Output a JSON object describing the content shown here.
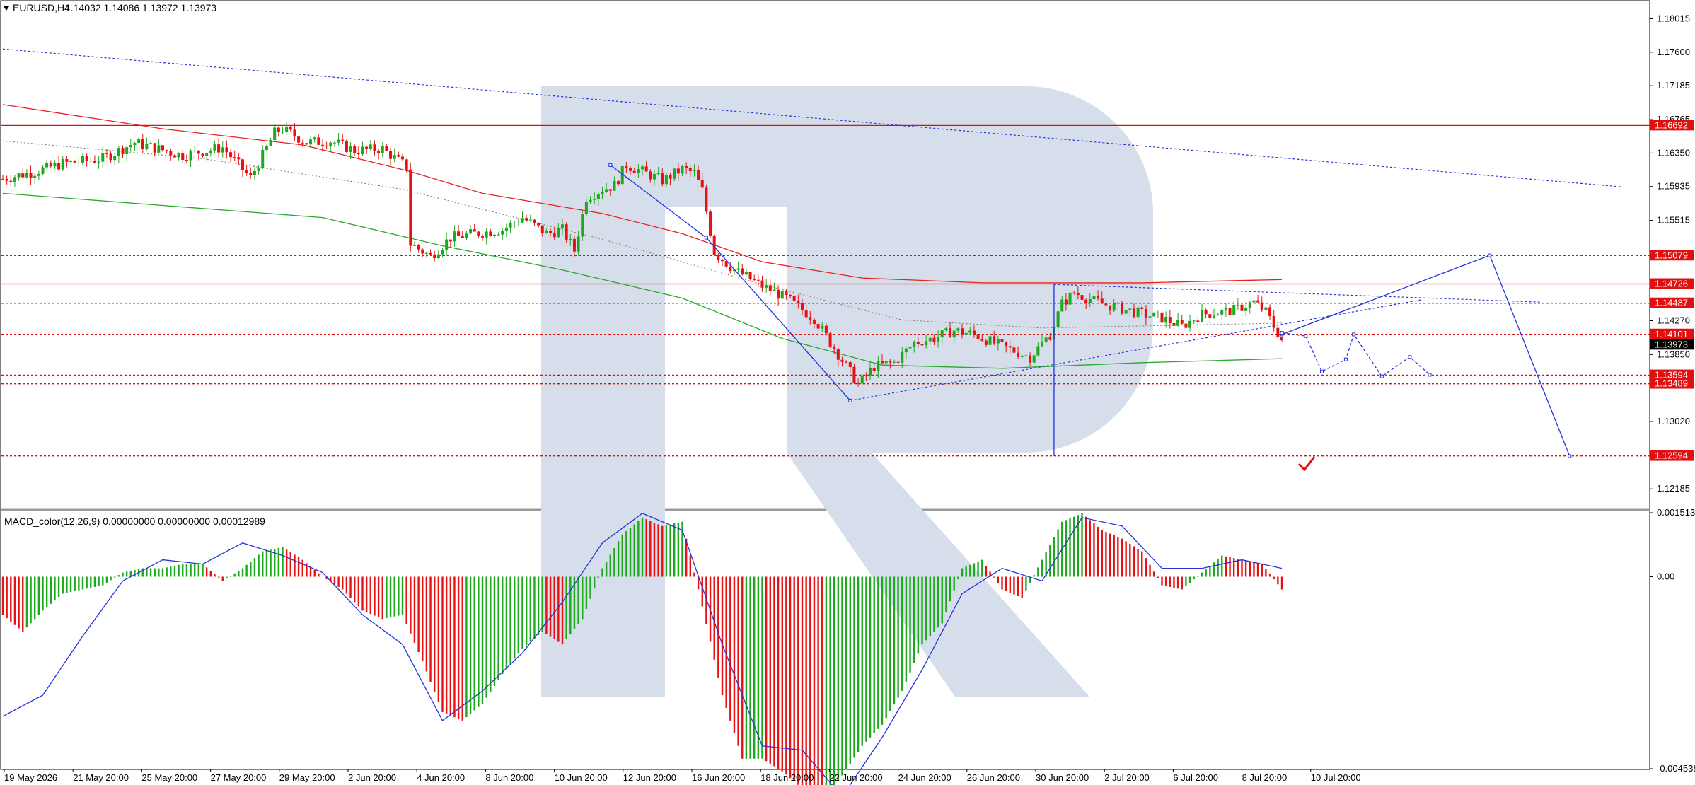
{
  "symbol_header": {
    "symbol": "EURUSD,H4",
    "ohlc": "1.14032 1.14086 1.13972 1.13973"
  },
  "indicator_header": "MACD_color(12,26,9) 0.00000000 0.00000000 0.00012989",
  "colors": {
    "bull": "#1ea81e",
    "bear": "#e81010",
    "ma_fast": "#e82020",
    "ma_slow": "#2aa82a",
    "forecast": "#2233dd",
    "watermark": "#d5deea",
    "level_line": "#e01010",
    "current_price_bg": "#000000"
  },
  "chart_data": {
    "type": "candlestick",
    "ylim": [
      1.1195,
      1.1823
    ],
    "y_ticks": [
      "1.18015",
      "1.17600",
      "1.17185",
      "1.16765",
      "1.16350",
      "1.15935",
      "1.15515",
      "1.15095",
      "1.14270",
      "1.13850",
      "1.13020",
      "1.12185"
    ],
    "x_ticks": [
      "19 May 2026",
      "21 May 20:00",
      "25 May 20:00",
      "27 May 20:00",
      "29 May 20:00",
      "2 Jun 20:00",
      "4 Jun 20:00",
      "8 Jun 20:00",
      "10 Jun 20:00",
      "12 Jun 20:00",
      "16 Jun 20:00",
      "18 Jun 20:00",
      "22 Jun 20:00",
      "24 Jun 20:00",
      "26 Jun 20:00",
      "30 Jun 20:00",
      "2 Jul 20:00",
      "6 Jul 20:00",
      "8 Jul 20:00",
      "10 Jul 20:00"
    ],
    "price_path": [
      [
        0,
        1.1603
      ],
      [
        8,
        1.1612
      ],
      [
        15,
        1.1622
      ],
      [
        25,
        1.1628
      ],
      [
        33,
        1.1648
      ],
      [
        45,
        1.1632
      ],
      [
        55,
        1.1642
      ],
      [
        62,
        1.1604
      ],
      [
        68,
        1.166
      ],
      [
        70,
        1.1665
      ],
      [
        76,
        1.1648
      ],
      [
        82,
        1.165
      ],
      [
        88,
        1.1638
      ],
      [
        95,
        1.164
      ],
      [
        101,
        1.1618
      ],
      [
        102,
        1.1522
      ],
      [
        107,
        1.1507
      ],
      [
        112,
        1.153
      ],
      [
        118,
        1.1535
      ],
      [
        125,
        1.154
      ],
      [
        130,
        1.1555
      ],
      [
        136,
        1.1535
      ],
      [
        140,
        1.154
      ],
      [
        143,
        1.1514
      ],
      [
        146,
        1.158
      ],
      [
        150,
        1.159
      ],
      [
        153,
        1.1595
      ],
      [
        156,
        1.162
      ],
      [
        160,
        1.1612
      ],
      [
        165,
        1.1601
      ],
      [
        170,
        1.1615
      ],
      [
        173,
        1.161
      ],
      [
        175,
        1.1588
      ],
      [
        178,
        1.1512
      ],
      [
        183,
        1.149
      ],
      [
        190,
        1.147
      ],
      [
        196,
        1.1455
      ],
      [
        203,
        1.143
      ],
      [
        210,
        1.1378
      ],
      [
        214,
        1.1348
      ],
      [
        218,
        1.137
      ],
      [
        223,
        1.1375
      ],
      [
        228,
        1.14
      ],
      [
        233,
        1.1405
      ],
      [
        238,
        1.1415
      ],
      [
        243,
        1.141
      ],
      [
        250,
        1.1395
      ],
      [
        257,
        1.1382
      ],
      [
        262,
        1.141
      ],
      [
        265,
        1.1448
      ],
      [
        268,
        1.1462
      ],
      [
        275,
        1.1448
      ],
      [
        283,
        1.1438
      ],
      [
        290,
        1.143
      ],
      [
        295,
        1.142
      ],
      [
        300,
        1.1435
      ],
      [
        308,
        1.144
      ],
      [
        313,
        1.145
      ],
      [
        316,
        1.1438
      ],
      [
        318,
        1.142
      ],
      [
        320,
        1.1403
      ]
    ],
    "ma_red": [
      [
        0,
        1.1695
      ],
      [
        40,
        1.1665
      ],
      [
        75,
        1.1645
      ],
      [
        102,
        1.1612
      ],
      [
        120,
        1.1585
      ],
      [
        150,
        1.156
      ],
      [
        170,
        1.1535
      ],
      [
        190,
        1.15
      ],
      [
        215,
        1.148
      ],
      [
        245,
        1.1474
      ],
      [
        285,
        1.1474
      ],
      [
        320,
        1.1478
      ]
    ],
    "ma_green": [
      [
        0,
        1.1585
      ],
      [
        40,
        1.157
      ],
      [
        80,
        1.1555
      ],
      [
        110,
        1.152
      ],
      [
        140,
        1.149
      ],
      [
        170,
        1.1455
      ],
      [
        195,
        1.1405
      ],
      [
        220,
        1.1372
      ],
      [
        250,
        1.1368
      ],
      [
        285,
        1.1375
      ],
      [
        320,
        1.138
      ]
    ],
    "ma_dotted": [
      [
        0,
        1.165
      ],
      [
        50,
        1.1628
      ],
      [
        100,
        1.159
      ],
      [
        150,
        1.1528
      ],
      [
        190,
        1.1472
      ],
      [
        225,
        1.1428
      ],
      [
        260,
        1.1418
      ],
      [
        290,
        1.1421
      ],
      [
        320,
        1.1424
      ]
    ],
    "levels": [
      {
        "price": 1.16692,
        "label": "1.16692",
        "style": "solid"
      },
      {
        "price": 1.15079,
        "label": "1.15079",
        "style": "dotted"
      },
      {
        "price": 1.14726,
        "label": "1.14726",
        "style": "solid"
      },
      {
        "price": 1.14487,
        "label": "1.14487",
        "style": "dotted"
      },
      {
        "price": 1.14101,
        "label": "1.14101",
        "style": "dotted"
      },
      {
        "price": 1.13594,
        "label": "1.13594",
        "style": "dotted"
      },
      {
        "price": 1.13489,
        "label": "1.13489",
        "style": "dotted"
      },
      {
        "price": 1.12594,
        "label": "1.12594",
        "style": "dotted"
      }
    ],
    "current_price": "1.13973",
    "trendlines": [
      {
        "from": [
          0,
          1.1764
        ],
        "to": [
          405,
          1.1593
        ],
        "style": "dotted"
      },
      {
        "from": [
          263,
          1.1472
        ],
        "to": [
          385,
          1.145
        ],
        "style": "dotted"
      },
      {
        "from": [
          212,
          1.1328
        ],
        "to": [
          355,
          1.1453
        ],
        "style": "dotted"
      }
    ],
    "forecast_solid": [
      [
        152,
        1.162
      ],
      [
        176,
        1.153
      ],
      [
        212,
        1.1328
      ]
    ],
    "forecast_vertical": {
      "x": 263,
      "from": 1.1472,
      "to": 1.1259
    },
    "forecast_zigzag_solid": [
      [
        320,
        1.141
      ],
      [
        372,
        1.1508
      ],
      [
        392,
        1.1259
      ]
    ],
    "forecast_zigzag_dotted": [
      [
        320,
        1.1412
      ],
      [
        326,
        1.1408
      ],
      [
        330,
        1.1364
      ],
      [
        336,
        1.1379
      ],
      [
        338,
        1.141
      ],
      [
        345,
        1.1358
      ],
      [
        352,
        1.1382
      ],
      [
        357,
        1.136
      ]
    ],
    "macd": {
      "ylim": [
        -0.004539,
        0.0015135
      ],
      "y_ticks": [
        "0.0015135",
        "0.00",
        "-0.0045389"
      ],
      "histogram": [
        [
          0,
          -0.0009
        ],
        [
          5,
          -0.0013
        ],
        [
          10,
          -0.0008
        ],
        [
          15,
          -0.0004
        ],
        [
          20,
          -0.0003
        ],
        [
          25,
          -0.0002
        ],
        [
          30,
          0.0001
        ],
        [
          35,
          0.0002
        ],
        [
          40,
          0.0002
        ],
        [
          45,
          0.0003
        ],
        [
          50,
          0.0003
        ],
        [
          55,
          -0.0001
        ],
        [
          60,
          0.0002
        ],
        [
          65,
          0.0006
        ],
        [
          70,
          0.0007
        ],
        [
          75,
          0.0004
        ],
        [
          80,
          0.0
        ],
        [
          85,
          -0.0003
        ],
        [
          90,
          -0.0008
        ],
        [
          95,
          -0.001
        ],
        [
          100,
          -0.0009
        ],
        [
          105,
          -0.002
        ],
        [
          110,
          -0.0032
        ],
        [
          115,
          -0.0034
        ],
        [
          120,
          -0.003
        ],
        [
          125,
          -0.0023
        ],
        [
          130,
          -0.0017
        ],
        [
          135,
          -0.0013
        ],
        [
          140,
          -0.0016
        ],
        [
          145,
          -0.001
        ],
        [
          150,
          0.0002
        ],
        [
          155,
          0.001
        ],
        [
          160,
          0.0014
        ],
        [
          165,
          0.0012
        ],
        [
          170,
          0.0013
        ],
        [
          175,
          -0.0007
        ],
        [
          180,
          -0.0028
        ],
        [
          185,
          -0.0043
        ],
        [
          190,
          -0.0043
        ],
        [
          195,
          -0.0046
        ],
        [
          200,
          -0.005
        ],
        [
          205,
          -0.0053
        ],
        [
          210,
          -0.0047
        ],
        [
          215,
          -0.004
        ],
        [
          220,
          -0.0035
        ],
        [
          225,
          -0.0027
        ],
        [
          230,
          -0.0016
        ],
        [
          235,
          -0.0011
        ],
        [
          240,
          0.0002
        ],
        [
          245,
          0.0004
        ],
        [
          250,
          -0.0003
        ],
        [
          255,
          -0.0005
        ],
        [
          260,
          0.0004
        ],
        [
          265,
          0.0013
        ],
        [
          270,
          0.0015
        ],
        [
          275,
          0.0011
        ],
        [
          280,
          0.0009
        ],
        [
          285,
          0.0006
        ],
        [
          290,
          -0.0002
        ],
        [
          295,
          -0.0003
        ],
        [
          300,
          0.0001
        ],
        [
          305,
          0.0005
        ],
        [
          310,
          0.0004
        ],
        [
          315,
          0.0003
        ],
        [
          320,
          -0.0003
        ]
      ],
      "signal": [
        [
          0,
          -0.0033
        ],
        [
          10,
          -0.0028
        ],
        [
          20,
          -0.0014
        ],
        [
          30,
          -0.0001
        ],
        [
          40,
          0.0004
        ],
        [
          50,
          0.0003
        ],
        [
          60,
          0.0008
        ],
        [
          70,
          0.0005
        ],
        [
          80,
          0.0001
        ],
        [
          90,
          -0.0009
        ],
        [
          100,
          -0.0016
        ],
        [
          110,
          -0.0034
        ],
        [
          120,
          -0.0027
        ],
        [
          130,
          -0.0018
        ],
        [
          140,
          -0.0006
        ],
        [
          150,
          0.0008
        ],
        [
          160,
          0.0015
        ],
        [
          170,
          0.0011
        ],
        [
          180,
          -0.0016
        ],
        [
          190,
          -0.004
        ],
        [
          200,
          -0.0041
        ],
        [
          210,
          -0.0052
        ],
        [
          220,
          -0.0038
        ],
        [
          230,
          -0.0022
        ],
        [
          240,
          -0.0004
        ],
        [
          250,
          0.0002
        ],
        [
          260,
          -0.0001
        ],
        [
          270,
          0.0014
        ],
        [
          280,
          0.0012
        ],
        [
          290,
          0.0002
        ],
        [
          300,
          0.0002
        ],
        [
          310,
          0.0004
        ],
        [
          320,
          0.0002
        ]
      ]
    }
  }
}
